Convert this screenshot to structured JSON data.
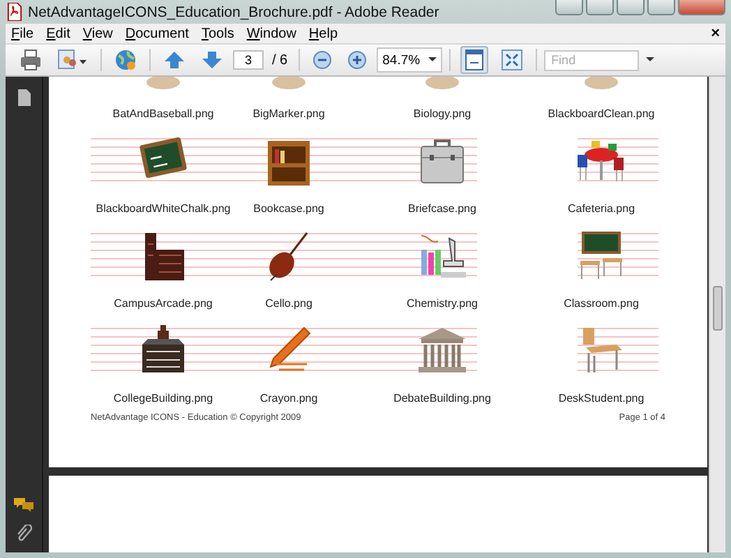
{
  "window": {
    "title": "NetAdvantageICONS_Education_Brochure.pdf - Adobe Reader"
  },
  "menu": {
    "items": [
      {
        "label": "File"
      },
      {
        "label": "Edit"
      },
      {
        "label": "View"
      },
      {
        "label": "Document"
      },
      {
        "label": "Tools"
      },
      {
        "label": "Window"
      },
      {
        "label": "Help"
      }
    ],
    "close": "×"
  },
  "toolbar": {
    "page_current": "3",
    "page_total": "/ 6",
    "zoom": "84.7%",
    "find_placeholder": "Find",
    "fit_page_pressed": true
  },
  "page": {
    "top_labels": [
      "BatAndBaseball.png",
      "BigMarker.png",
      "Biology.png",
      "BlackboardClean.png"
    ],
    "items": [
      {
        "label": "BlackboardWhiteChalk.png"
      },
      {
        "label": "Bookcase.png"
      },
      {
        "label": "Briefcase.png"
      },
      {
        "label": "Cafeteria.png"
      },
      {
        "label": "CampusArcade.png"
      },
      {
        "label": "Cello.png"
      },
      {
        "label": "Chemistry.png"
      },
      {
        "label": "Classroom.png"
      },
      {
        "label": "CollegeBuilding.png"
      },
      {
        "label": "Crayon.png"
      },
      {
        "label": "DebateBuilding.png"
      },
      {
        "label": "DeskStudent.png"
      }
    ],
    "footer_left": "NetAdvantage ICONS - Education © Copyright 2009",
    "footer_right": "Page 1 of 4"
  }
}
